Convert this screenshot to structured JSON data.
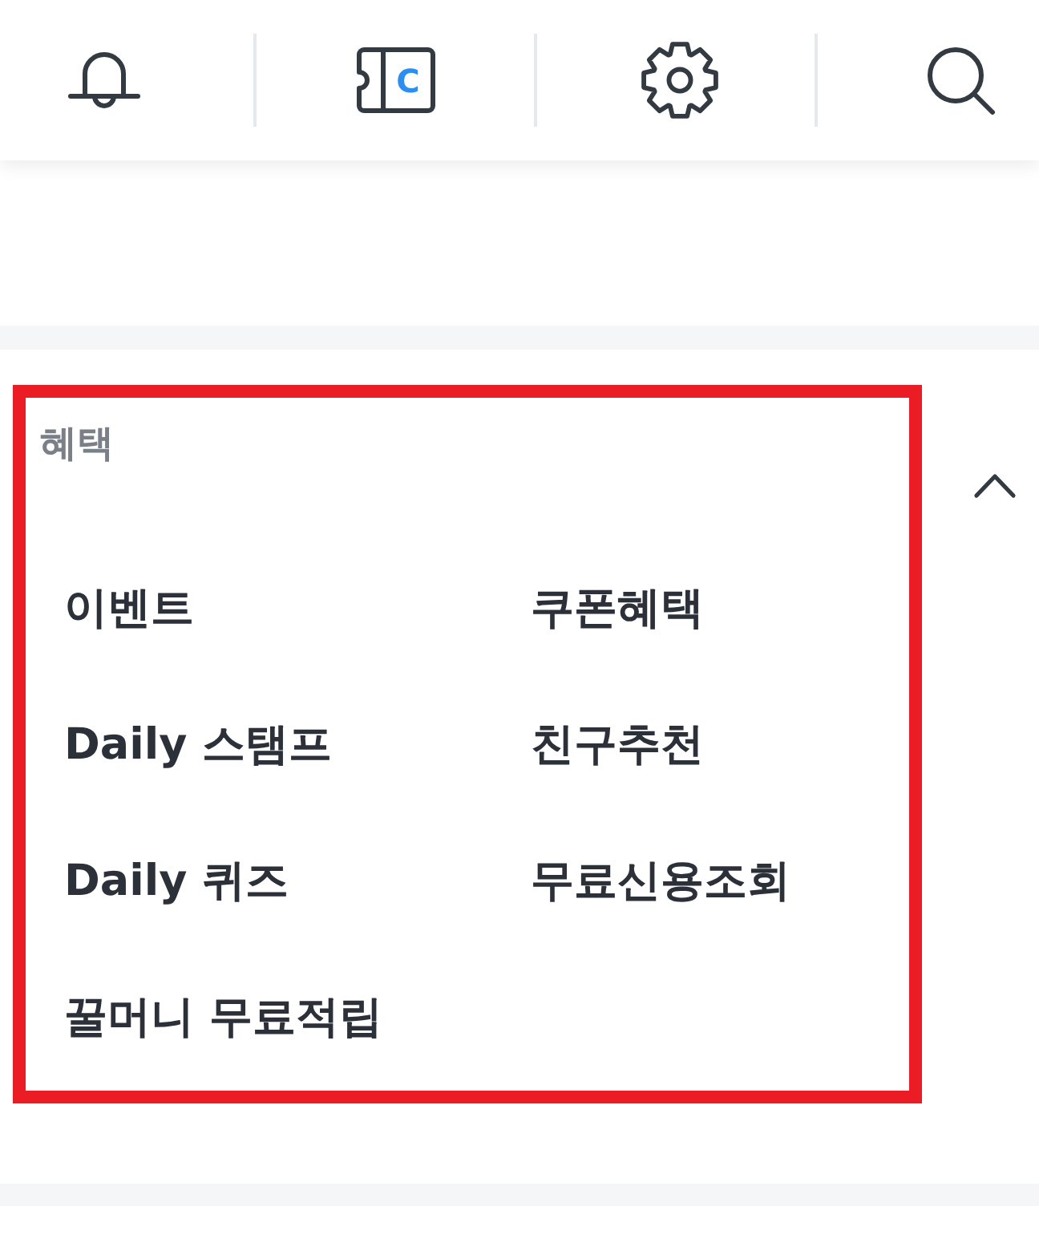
{
  "header": {
    "buttons": [
      {
        "kind": "bell"
      },
      {
        "kind": "ticket",
        "letter": "C"
      },
      {
        "kind": "settings"
      },
      {
        "kind": "search"
      }
    ]
  },
  "benefits": {
    "title": "혜택",
    "expanded": true,
    "highlighted": true,
    "items": [
      "이벤트",
      "쿠폰혜택",
      "Daily 스탬프",
      "친구추천",
      "Daily 퀴즈",
      "무료신용조회",
      "꿀머니 무료적립"
    ]
  }
}
